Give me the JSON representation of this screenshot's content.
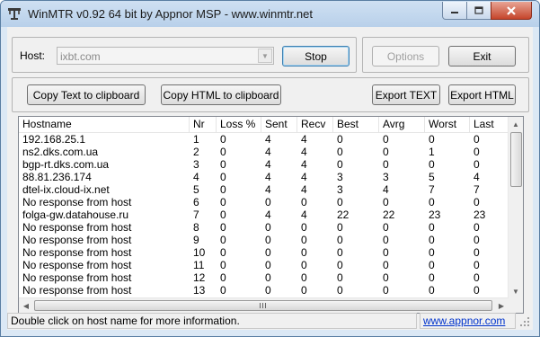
{
  "window": {
    "title": "WinMTR v0.92 64 bit by Appnor MSP - www.winmtr.net"
  },
  "host": {
    "label": "Host:",
    "value": "ixbt.com"
  },
  "buttons": {
    "stop": "Stop",
    "options": "Options",
    "exit": "Exit",
    "copy_text": "Copy Text to clipboard",
    "copy_html": "Copy HTML to clipboard",
    "export_text": "Export TEXT",
    "export_html": "Export HTML"
  },
  "table": {
    "columns": [
      "Hostname",
      "Nr",
      "Loss %",
      "Sent",
      "Recv",
      "Best",
      "Avrg",
      "Worst",
      "Last"
    ],
    "rows": [
      [
        "192.168.25.1",
        "1",
        "0",
        "4",
        "4",
        "0",
        "0",
        "0",
        "0"
      ],
      [
        "ns2.dks.com.ua",
        "2",
        "0",
        "4",
        "4",
        "0",
        "0",
        "1",
        "0"
      ],
      [
        "bgp-rt.dks.com.ua",
        "3",
        "0",
        "4",
        "4",
        "0",
        "0",
        "0",
        "0"
      ],
      [
        "88.81.236.174",
        "4",
        "0",
        "4",
        "4",
        "3",
        "3",
        "5",
        "4"
      ],
      [
        "dtel-ix.cloud-ix.net",
        "5",
        "0",
        "4",
        "4",
        "3",
        "4",
        "7",
        "7"
      ],
      [
        "No response from host",
        "6",
        "0",
        "0",
        "0",
        "0",
        "0",
        "0",
        "0"
      ],
      [
        "folga-gw.datahouse.ru",
        "7",
        "0",
        "4",
        "4",
        "22",
        "22",
        "23",
        "23"
      ],
      [
        "No response from host",
        "8",
        "0",
        "0",
        "0",
        "0",
        "0",
        "0",
        "0"
      ],
      [
        "No response from host",
        "9",
        "0",
        "0",
        "0",
        "0",
        "0",
        "0",
        "0"
      ],
      [
        "No response from host",
        "10",
        "0",
        "0",
        "0",
        "0",
        "0",
        "0",
        "0"
      ],
      [
        "No response from host",
        "11",
        "0",
        "0",
        "0",
        "0",
        "0",
        "0",
        "0"
      ],
      [
        "No response from host",
        "12",
        "0",
        "0",
        "0",
        "0",
        "0",
        "0",
        "0"
      ],
      [
        "No response from host",
        "13",
        "0",
        "0",
        "0",
        "0",
        "0",
        "0",
        "0"
      ]
    ]
  },
  "status": {
    "message": "Double click on host name for more information.",
    "link": "www.appnor.com"
  },
  "icons": {
    "minimize": "minimize-icon",
    "maximize": "maximize-icon",
    "close": "close-icon",
    "app": "winmtr-app-icon"
  }
}
